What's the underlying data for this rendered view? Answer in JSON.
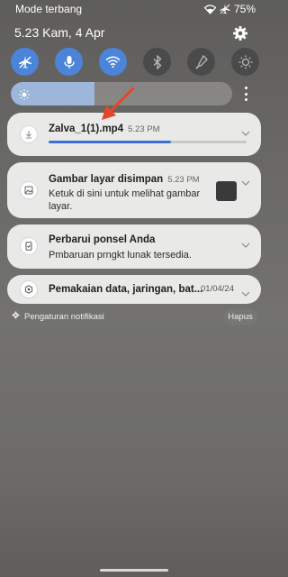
{
  "status_bar": {
    "mode": "Mode terbang",
    "battery": "75%",
    "icons": [
      "wifi-icon",
      "airplane-icon",
      "battery-icon"
    ]
  },
  "header": {
    "datetime": "5.23  Kam, 4 Apr",
    "settings_icon": "gear-icon"
  },
  "quick_toggles": [
    {
      "icon": "airplane-icon",
      "state": "on"
    },
    {
      "icon": "microphone-icon",
      "state": "on"
    },
    {
      "icon": "wifi-icon",
      "state": "on"
    },
    {
      "icon": "bluetooth-icon",
      "state": "off"
    },
    {
      "icon": "flashlight-icon",
      "state": "off"
    },
    {
      "icon": "brightness-mode-icon",
      "state": "off"
    }
  ],
  "brightness": {
    "level": 0.38,
    "icon": "sun-icon"
  },
  "notifications": [
    {
      "app_icon": "download-icon",
      "title": "Zalva_1(1).mp4",
      "time": "5.23 PM",
      "progress": 0.62
    },
    {
      "app_icon": "image-icon",
      "title": "Gambar layar disimpan",
      "time": "5.23 PM",
      "text": "Ketuk di sini untuk melihat gambar layar."
    },
    {
      "app_icon": "update-icon",
      "title": "Perbarui ponsel Anda",
      "text": "Pmbaruan prngkt lunak tersedia."
    },
    {
      "app_icon": "data-usage-icon",
      "title": "Pemakaian data, jaringan, bat...",
      "date": "01/04/24"
    }
  ],
  "footer": {
    "settings_label": "Pengaturan notifikasi",
    "clear_label": "Hapus"
  },
  "colors": {
    "accent": "#4b84d8",
    "card_bg": "#e9e9e8",
    "arrow": "#e8442a"
  }
}
